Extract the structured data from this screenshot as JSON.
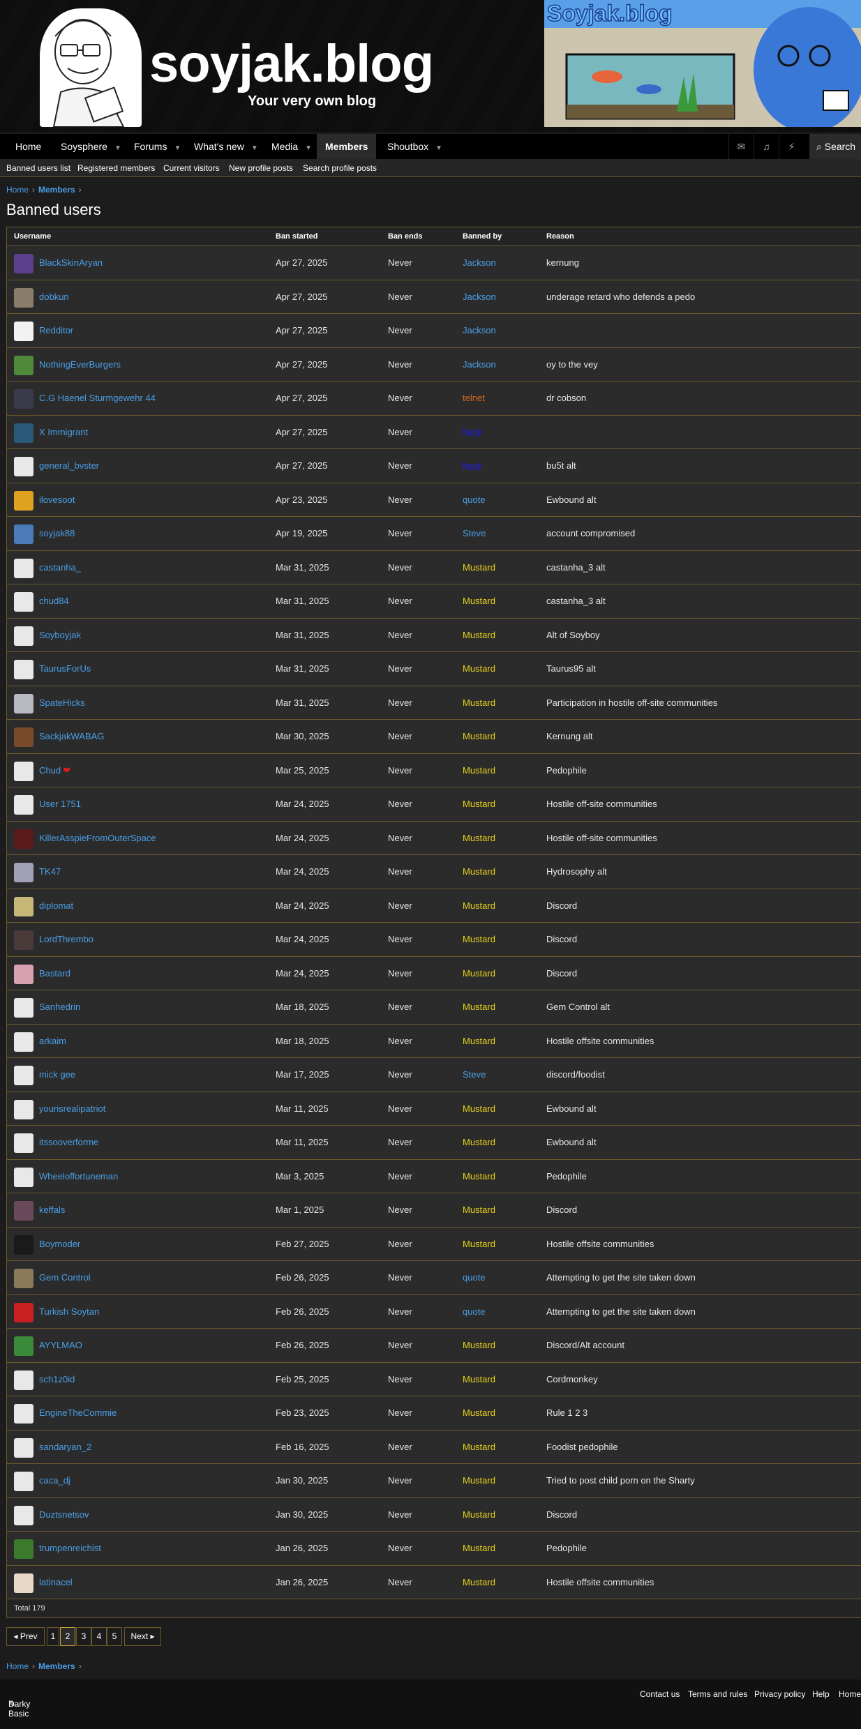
{
  "site": {
    "title": "soyjak.blog",
    "subtitle": "Your very own blog",
    "banner_text": "Soyjak.blog"
  },
  "nav": {
    "items": [
      {
        "label": "Home",
        "caret": false
      },
      {
        "label": "Soysphere",
        "caret": true
      },
      {
        "label": "Forums",
        "caret": true
      },
      {
        "label": "What's new",
        "caret": true
      },
      {
        "label": "Media",
        "caret": true
      },
      {
        "label": "Members",
        "caret": true,
        "active": true
      },
      {
        "label": "Shoutbox",
        "caret": true
      }
    ],
    "icons": [
      "mail-icon",
      "bell-icon",
      "bolt-icon"
    ],
    "search_label": "Search"
  },
  "subnav": [
    "Banned users list",
    "Registered members",
    "Current visitors",
    "New profile posts",
    "Search profile posts"
  ],
  "breadcrumb": {
    "home": "Home",
    "members": "Members"
  },
  "page_title": "Banned users",
  "table": {
    "headers": [
      "Username",
      "Ban started",
      "Ban ends",
      "Banned by",
      "Reason"
    ],
    "rows": [
      {
        "user": "BlackSkinAryan",
        "start": "Apr 27, 2025",
        "end": "Never",
        "by": "Jackson",
        "reason": "kernung",
        "by_color": "#4a9fe8",
        "avatar": "#5a3f8a"
      },
      {
        "user": "dobkun",
        "start": "Apr 27, 2025",
        "end": "Never",
        "by": "Jackson",
        "reason": "underage retard who defends a pedo",
        "by_color": "#4a9fe8",
        "avatar": "#8a7e6a"
      },
      {
        "user": "Redditor",
        "start": "Apr 27, 2025",
        "end": "Never",
        "by": "Jackson",
        "reason": "",
        "by_color": "#4a9fe8",
        "avatar": "#f2f2f2"
      },
      {
        "user": "NothingEverBurgers",
        "start": "Apr 27, 2025",
        "end": "Never",
        "by": "Jackson",
        "reason": "oy to the vey",
        "by_color": "#4a9fe8",
        "avatar": "#4f8a3a"
      },
      {
        "user": "C.G Haenel Sturmgewehr 44",
        "start": "Apr 27, 2025",
        "end": "Never",
        "by": "telnet",
        "reason": "dr cobson",
        "by_color": "#d2691e",
        "avatar": "#3a3a4a"
      },
      {
        "user": "X Immigrant",
        "start": "Apr 27, 2025",
        "end": "Never",
        "by": "fugly",
        "reason": "",
        "by_color": "#1a1aff",
        "avatar": "#2a5a7a"
      },
      {
        "user": "general_bvster",
        "start": "Apr 27, 2025",
        "end": "Never",
        "by": "fugly",
        "reason": "bu5t alt",
        "by_color": "#1a1aff",
        "avatar": "#e8e8e8"
      },
      {
        "user": "ilovesoot",
        "start": "Apr 23, 2025",
        "end": "Never",
        "by": "quote",
        "reason": "Ewbound alt",
        "by_color": "#4a9fe8",
        "avatar": "#e0a020"
      },
      {
        "user": "soyjak88",
        "start": "Apr 19, 2025",
        "end": "Never",
        "by": "Steve",
        "reason": "account compromised",
        "by_color": "#4a9fe8",
        "avatar": "#4a7ab8"
      },
      {
        "user": "castanha_",
        "start": "Mar 31, 2025",
        "end": "Never",
        "by": "Mustard",
        "reason": "castanha_3 alt",
        "by_color": "#e8d21a",
        "avatar": "#e8e8e8"
      },
      {
        "user": "chud84",
        "start": "Mar 31, 2025",
        "end": "Never",
        "by": "Mustard",
        "reason": "castanha_3 alt",
        "by_color": "#e8d21a",
        "avatar": "#e8e8e8"
      },
      {
        "user": "Soyboyjak",
        "start": "Mar 31, 2025",
        "end": "Never",
        "by": "Mustard",
        "reason": "Alt of Soyboy",
        "by_color": "#e8d21a",
        "avatar": "#e8e8e8"
      },
      {
        "user": "TaurusForUs",
        "start": "Mar 31, 2025",
        "end": "Never",
        "by": "Mustard",
        "reason": "Taurus95 alt",
        "by_color": "#e8d21a",
        "avatar": "#e8e8e8"
      },
      {
        "user": "SpateHicks",
        "start": "Mar 31, 2025",
        "end": "Never",
        "by": "Mustard",
        "reason": "Participation in hostile off-site communities",
        "by_color": "#e8d21a",
        "avatar": "#b8b8c0"
      },
      {
        "user": "SackjakWABAG",
        "start": "Mar 30, 2025",
        "end": "Never",
        "by": "Mustard",
        "reason": "Kernung alt",
        "by_color": "#e8d21a",
        "avatar": "#7a4a2a"
      },
      {
        "user": "Chud",
        "start": "Mar 25, 2025",
        "end": "Never",
        "by": "Mustard",
        "reason": "Pedophile",
        "by_color": "#e8d21a",
        "avatar": "#e8e8e8",
        "heart": "❤"
      },
      {
        "user": "User 1751",
        "start": "Mar 24, 2025",
        "end": "Never",
        "by": "Mustard",
        "reason": "Hostile off-site communities",
        "by_color": "#e8d21a",
        "avatar": "#e8e8e8"
      },
      {
        "user": "KillerAsspieFromOuterSpace",
        "start": "Mar 24, 2025",
        "end": "Never",
        "by": "Mustard",
        "reason": "Hostile off-site communities",
        "by_color": "#e8d21a",
        "avatar": "#5a1a1a"
      },
      {
        "user": "TK47",
        "start": "Mar 24, 2025",
        "end": "Never",
        "by": "Mustard",
        "reason": "Hydrosophy alt",
        "by_color": "#e8d21a",
        "avatar": "#a0a0b8"
      },
      {
        "user": "diplomat",
        "start": "Mar 24, 2025",
        "end": "Never",
        "by": "Mustard",
        "reason": "Discord",
        "by_color": "#e8d21a",
        "avatar": "#c8b878"
      },
      {
        "user": "LordThrembo",
        "start": "Mar 24, 2025",
        "end": "Never",
        "by": "Mustard",
        "reason": "Discord",
        "by_color": "#e8d21a",
        "avatar": "#4a3a3a"
      },
      {
        "user": "Bastard",
        "start": "Mar 24, 2025",
        "end": "Never",
        "by": "Mustard",
        "reason": "Discord",
        "by_color": "#e8d21a",
        "avatar": "#d8a0b0"
      },
      {
        "user": "Sanhedrin",
        "start": "Mar 18, 2025",
        "end": "Never",
        "by": "Mustard",
        "reason": "Gem Control alt",
        "by_color": "#e8d21a",
        "avatar": "#e8e8e8"
      },
      {
        "user": "arkaim",
        "start": "Mar 18, 2025",
        "end": "Never",
        "by": "Mustard",
        "reason": "Hostile offsite communities",
        "by_color": "#e8d21a",
        "avatar": "#e8e8e8"
      },
      {
        "user": "mick gee",
        "start": "Mar 17, 2025",
        "end": "Never",
        "by": "Steve",
        "reason": "discord/foodist",
        "by_color": "#4a9fe8",
        "avatar": "#e8e8e8"
      },
      {
        "user": "yourisrealipatriot",
        "start": "Mar 11, 2025",
        "end": "Never",
        "by": "Mustard",
        "reason": "Ewbound alt",
        "by_color": "#e8d21a",
        "avatar": "#e8e8e8"
      },
      {
        "user": "itssooverforme",
        "start": "Mar 11, 2025",
        "end": "Never",
        "by": "Mustard",
        "reason": "Ewbound alt",
        "by_color": "#e8d21a",
        "avatar": "#e8e8e8"
      },
      {
        "user": "Wheeloffortuneman",
        "start": "Mar 3, 2025",
        "end": "Never",
        "by": "Mustard",
        "reason": "Pedophile",
        "by_color": "#e8d21a",
        "avatar": "#e8e8e8"
      },
      {
        "user": "keffals",
        "start": "Mar 1, 2025",
        "end": "Never",
        "by": "Mustard",
        "reason": "Discord",
        "by_color": "#e8d21a",
        "avatar": "#6a4a5a"
      },
      {
        "user": "Boymoder",
        "start": "Feb 27, 2025",
        "end": "Never",
        "by": "Mustard",
        "reason": "Hostile offsite communities",
        "by_color": "#e8d21a",
        "avatar": "#1a1a1a"
      },
      {
        "user": "Gem Control",
        "start": "Feb 26, 2025",
        "end": "Never",
        "by": "quote",
        "reason": "Attempting to get the site taken down",
        "by_color": "#4a9fe8",
        "avatar": "#8a7a5a"
      },
      {
        "user": "Turkish Soytan",
        "start": "Feb 26, 2025",
        "end": "Never",
        "by": "quote",
        "reason": "Attempting to get the site taken down",
        "by_color": "#4a9fe8",
        "avatar": "#c82020"
      },
      {
        "user": "AYYLMAO",
        "start": "Feb 26, 2025",
        "end": "Never",
        "by": "Mustard",
        "reason": "Discord/Alt account",
        "by_color": "#e8d21a",
        "avatar": "#3a8a3a"
      },
      {
        "user": "sch1z0id",
        "start": "Feb 25, 2025",
        "end": "Never",
        "by": "Mustard",
        "reason": "Cordmonkey",
        "by_color": "#e8d21a",
        "avatar": "#e8e8e8"
      },
      {
        "user": "EngineTheCommie",
        "start": "Feb 23, 2025",
        "end": "Never",
        "by": "Mustard",
        "reason": "Rule 1 2 3",
        "by_color": "#e8d21a",
        "avatar": "#e8e8e8"
      },
      {
        "user": "sandaryan_2",
        "start": "Feb 16, 2025",
        "end": "Never",
        "by": "Mustard",
        "reason": "Foodist pedophile",
        "by_color": "#e8d21a",
        "avatar": "#e8e8e8"
      },
      {
        "user": "caca_dj",
        "start": "Jan 30, 2025",
        "end": "Never",
        "by": "Mustard",
        "reason": "Tried to post child porn on the Sharty",
        "by_color": "#e8d21a",
        "avatar": "#e8e8e8"
      },
      {
        "user": "Duztsnetsov",
        "start": "Jan 30, 2025",
        "end": "Never",
        "by": "Mustard",
        "reason": "Discord",
        "by_color": "#e8d21a",
        "avatar": "#e8e8e8"
      },
      {
        "user": "trumpenreichist",
        "start": "Jan 26, 2025",
        "end": "Never",
        "by": "Mustard",
        "reason": "Pedophile",
        "by_color": "#e8d21a",
        "avatar": "#3a7a2a"
      },
      {
        "user": "latinacel",
        "start": "Jan 26, 2025",
        "end": "Never",
        "by": "Mustard",
        "reason": "Hostile offsite communities",
        "by_color": "#e8d21a",
        "avatar": "#e8d8c8"
      }
    ],
    "total": "Total 179"
  },
  "pager": {
    "prev": "◂ Prev",
    "pages": [
      "1",
      "2",
      "3",
      "4",
      "5"
    ],
    "current": "2",
    "next": "Next ▸"
  },
  "footer": {
    "style": "Darky Basic",
    "links": [
      "Contact us",
      "Terms and rules",
      "Privacy policy",
      "Help",
      "Home"
    ]
  }
}
